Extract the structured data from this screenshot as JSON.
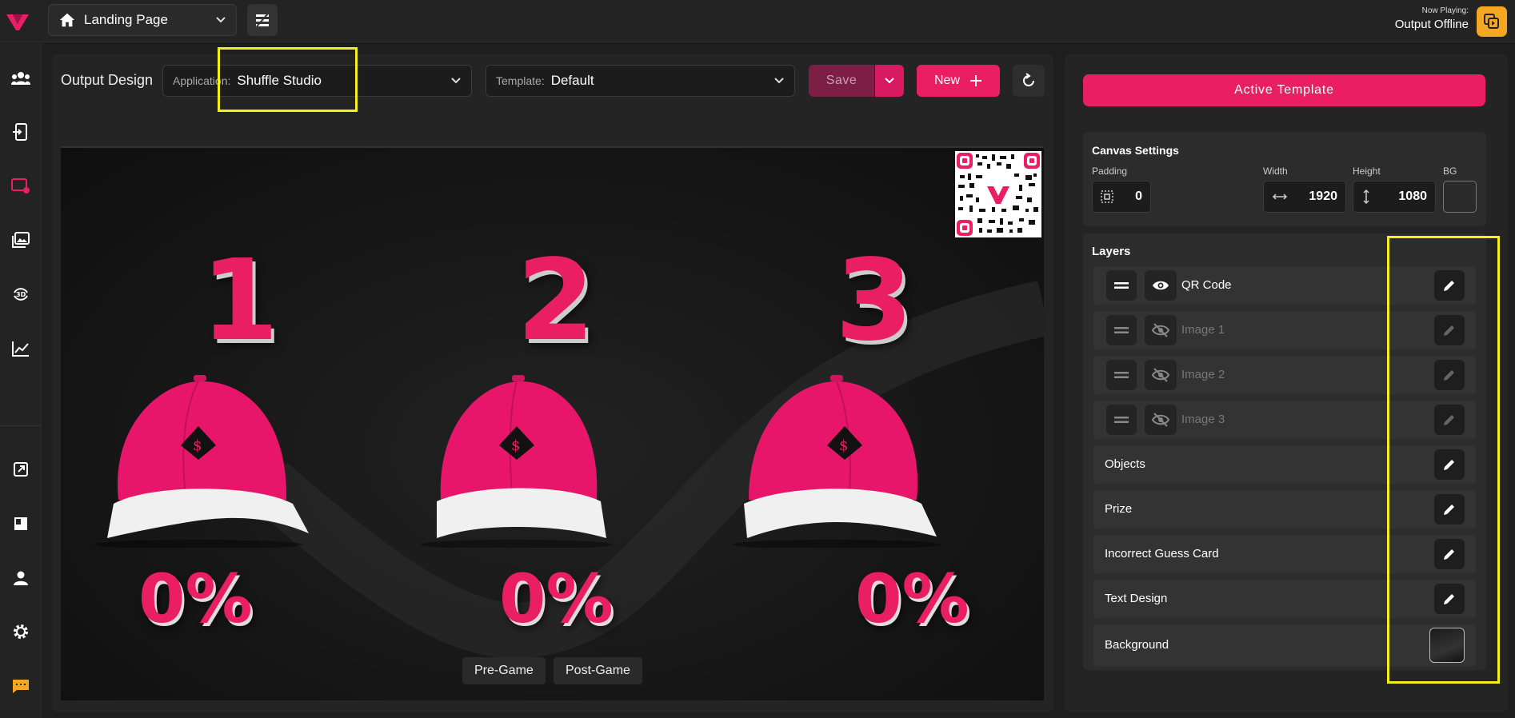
{
  "topbar": {
    "page_select": "Landing Page",
    "now_playing_label": "Now Playing:",
    "now_playing_value": "Output Offline"
  },
  "toolbar": {
    "title": "Output Design",
    "application_label": "Application:",
    "application_value": "Shuffle Studio",
    "template_label": "Template:",
    "template_value": "Default",
    "save_label": "Save",
    "new_label": "New"
  },
  "canvas": {
    "numbers": [
      "1",
      "2",
      "3"
    ],
    "percents": [
      "0%",
      "0%",
      "0%"
    ],
    "pre_game_label": "Pre-Game",
    "post_game_label": "Post-Game"
  },
  "right_panel": {
    "active_template_label": "Active Template",
    "canvas_settings": {
      "title": "Canvas Settings",
      "padding_label": "Padding",
      "padding_value": "0",
      "width_label": "Width",
      "width_value": "1920",
      "height_label": "Height",
      "height_value": "1080",
      "bg_label": "BG"
    },
    "layers_title": "Layers",
    "layers": [
      {
        "name": "QR Code",
        "visible": true
      },
      {
        "name": "Image 1",
        "visible": false
      },
      {
        "name": "Image 2",
        "visible": false
      },
      {
        "name": "Image 3",
        "visible": false
      }
    ],
    "groups": [
      "Objects",
      "Prize",
      "Incorrect Guess Card",
      "Text Design",
      "Background"
    ]
  },
  "colors": {
    "accent": "#e91e63",
    "highlight": "#f4ee1a",
    "output_button": "#f5a623"
  }
}
